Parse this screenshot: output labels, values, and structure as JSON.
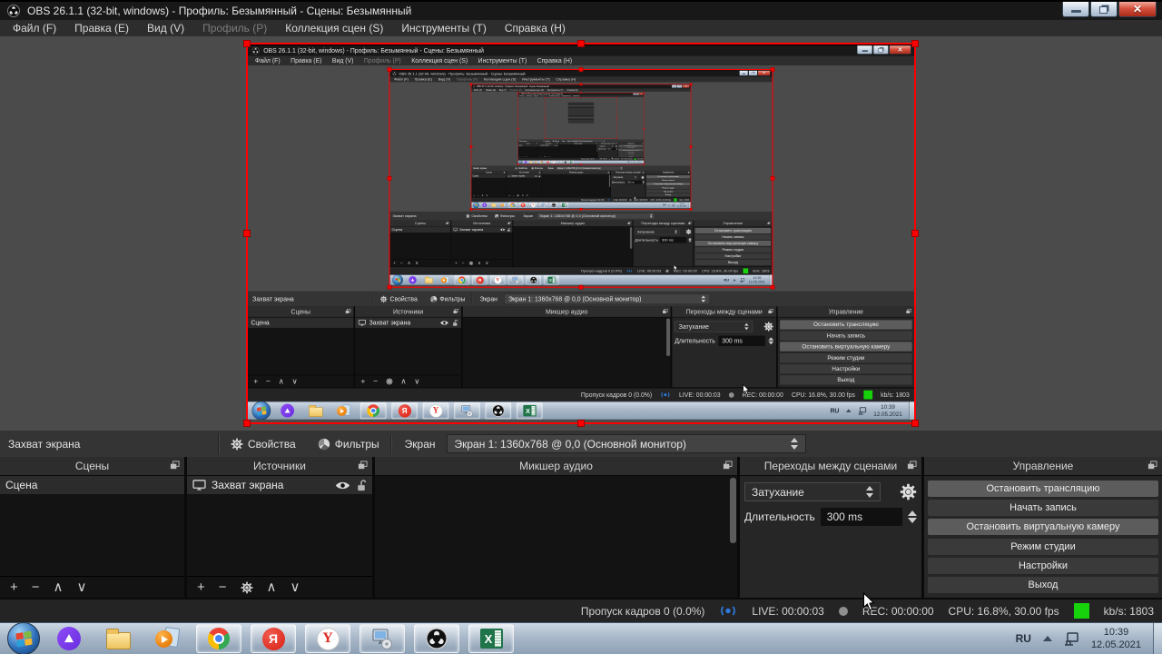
{
  "app": {
    "title": "OBS 26.1.1 (32-bit, windows) - Профиль: Безымянный - Сцены: Безымянный",
    "menu": [
      {
        "label": "Файл (F)",
        "enabled": true
      },
      {
        "label": "Правка (E)",
        "enabled": true
      },
      {
        "label": "Вид (V)",
        "enabled": true
      },
      {
        "label": "Профиль (P)",
        "enabled": false
      },
      {
        "label": "Коллекция сцен (S)",
        "enabled": true
      },
      {
        "label": "Инструменты (T)",
        "enabled": true
      },
      {
        "label": "Справка (H)",
        "enabled": true
      }
    ]
  },
  "source_toolbar": {
    "source_name": "Захват экрана",
    "properties": "Свойства",
    "filters": "Фильтры",
    "screen_label": "Экран",
    "screen_value": "Экран 1: 1360x768 @ 0,0 (Основной монитор)"
  },
  "panels": {
    "scenes": {
      "title": "Сцены",
      "items": [
        "Сцена"
      ]
    },
    "sources": {
      "title": "Источники",
      "items": [
        "Захват экрана"
      ]
    },
    "mixer": {
      "title": "Микшер аудио"
    },
    "transitions": {
      "title": "Переходы между сценами",
      "transition_value": "Затухание",
      "duration_label": "Длительность",
      "duration_value": "300 ms"
    },
    "controls": {
      "title": "Управление",
      "buttons": [
        {
          "label": "Остановить трансляцию",
          "active": true
        },
        {
          "label": "Начать запись",
          "active": false
        },
        {
          "label": "Остановить виртуальную камеру",
          "active": true
        },
        {
          "label": "Режим студии",
          "active": false
        },
        {
          "label": "Настройки",
          "active": false
        },
        {
          "label": "Выход",
          "active": false
        }
      ]
    }
  },
  "statusbar": {
    "dropped_frames": "Пропуск кадров 0 (0.0%)",
    "live": "LIVE: 00:00:03",
    "rec": "REC: 00:00:00",
    "cpu": "CPU: 16.8%, 30.00 fps",
    "bitrate": "kb/s: 1803"
  },
  "taskbar": {
    "language": "RU",
    "time": "10:39",
    "date": "12.05.2021",
    "icons": [
      {
        "name": "start"
      },
      {
        "name": "yandex-alice"
      },
      {
        "name": "explorer"
      },
      {
        "name": "media-player"
      },
      {
        "name": "chrome"
      },
      {
        "name": "yandex-browser",
        "letter": "Я"
      },
      {
        "name": "yandex",
        "letter": "Y"
      },
      {
        "name": "installer"
      },
      {
        "name": "obs"
      },
      {
        "name": "excel",
        "letter": "X"
      }
    ]
  },
  "glyphs": {
    "plus": "+",
    "minus": "−",
    "up": "∧",
    "down": "∨",
    "close": "✕"
  },
  "colors": {
    "selection_red": "#ff0000",
    "live_blue": "#2e7bde",
    "bitrate_green": "#16d30c"
  }
}
